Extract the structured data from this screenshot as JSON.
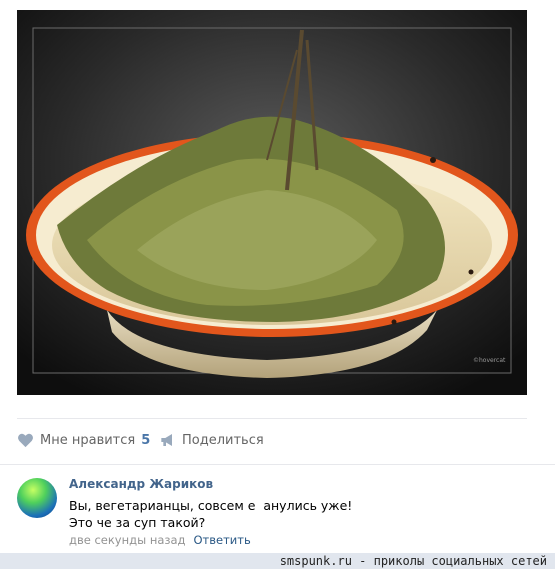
{
  "post": {
    "photo_description_icon": "bowl-of-birch-leaves-photo",
    "photo_signature": "©hovercat",
    "actions": {
      "like_label": "Мне нравится",
      "like_count": "5",
      "share_label": "Поделиться"
    }
  },
  "comment": {
    "author": "Александр Жариков",
    "line1": "Вы, вегетарианцы, совсем е  анулись уже!",
    "line2": "Это че за суп такой?",
    "time": "две секунды назад",
    "reply_label": "Ответить"
  },
  "footer": {
    "watermark": "smspunk.ru - приколы социальных сетей"
  },
  "colors": {
    "link": "#2a5885",
    "author": "#42648b",
    "like_count": "#4a76a8",
    "bowl_rim": "#e2561c"
  }
}
